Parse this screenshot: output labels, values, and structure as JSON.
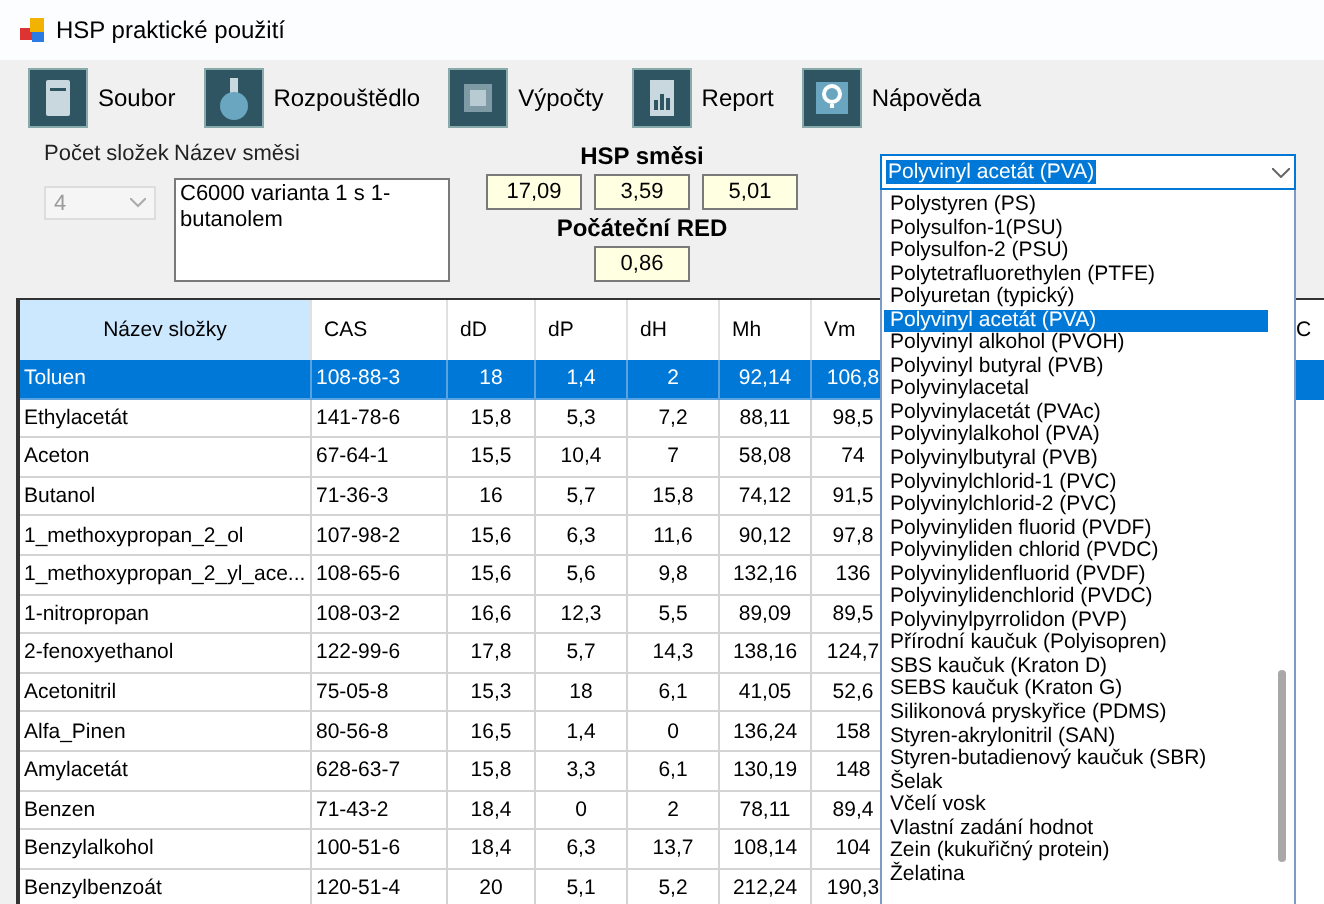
{
  "window": {
    "title": "HSP praktické použití"
  },
  "toolbar": [
    {
      "label": "Soubor"
    },
    {
      "label": "Rozpouštědlo"
    },
    {
      "label": "Výpočty"
    },
    {
      "label": "Report"
    },
    {
      "label": "Nápověda"
    }
  ],
  "component_count": {
    "label": "Počet složek",
    "value": "4",
    "disabled": true
  },
  "mixture_name": {
    "label": "Název směsi",
    "value": "C6000 varianta 1 s 1-butanolem"
  },
  "hsp_mixture": {
    "label": "HSP směsi",
    "values": [
      "17,09",
      "3,59",
      "5,01"
    ]
  },
  "initial_red": {
    "label": "Počáteční RED",
    "value": "0,86"
  },
  "polymer_select": {
    "value": "Polyvinyl acetát (PVA)",
    "expanded": true,
    "options": [
      {
        "label": "Polystyren (PS)",
        "selected": false
      },
      {
        "label": "Polysulfon-1(PSU)",
        "selected": false
      },
      {
        "label": "Polysulfon-2 (PSU)",
        "selected": false
      },
      {
        "label": "Polytetrafluorethylen (PTFE)",
        "selected": false
      },
      {
        "label": "Polyuretan (typický)",
        "selected": false
      },
      {
        "label": "Polyvinyl acetát (PVA)",
        "selected": true
      },
      {
        "label": "Polyvinyl alkohol (PVOH)",
        "selected": false
      },
      {
        "label": "Polyvinyl butyral (PVB)",
        "selected": false
      },
      {
        "label": "Polyvinylacetal",
        "selected": false
      },
      {
        "label": "Polyvinylacetát (PVAc)",
        "selected": false
      },
      {
        "label": "Polyvinylalkohol (PVA)",
        "selected": false
      },
      {
        "label": "Polyvinylbutyral (PVB)",
        "selected": false
      },
      {
        "label": "Polyvinylchlorid-1 (PVC)",
        "selected": false
      },
      {
        "label": "Polyvinylchlorid-2 (PVC)",
        "selected": false
      },
      {
        "label": "Polyvinyliden fluorid (PVDF)",
        "selected": false
      },
      {
        "label": "Polyvinyliden chlorid (PVDC)",
        "selected": false
      },
      {
        "label": "Polyvinylidenfluorid (PVDF)",
        "selected": false
      },
      {
        "label": "Polyvinylidenchlorid (PVDC)",
        "selected": false
      },
      {
        "label": "Polyvinylpyrrolidon (PVP)",
        "selected": false
      },
      {
        "label": "Přírodní kaučuk (Polyisopren)",
        "selected": false
      },
      {
        "label": "SBS kaučuk (Kraton D)",
        "selected": false
      },
      {
        "label": "SEBS kaučuk (Kraton G)",
        "selected": false
      },
      {
        "label": "Silikonová pryskyřice (PDMS)",
        "selected": false
      },
      {
        "label": "Styren-akrylonitril (SAN)",
        "selected": false
      },
      {
        "label": "Styren-butadienový kaučuk (SBR)",
        "selected": false
      },
      {
        "label": "Šelak",
        "selected": false
      },
      {
        "label": "Včelí vosk",
        "selected": false
      },
      {
        "label": "Vlastní zadání hodnot",
        "selected": false
      },
      {
        "label": "Zein (kukuřičný protein)",
        "selected": false
      },
      {
        "label": "Želatina",
        "selected": false
      }
    ]
  },
  "table": {
    "columns": [
      "Název složky",
      "CAS",
      "dD",
      "dP",
      "dH",
      "Mh",
      "Vm",
      "C"
    ],
    "rows": [
      {
        "selected": true,
        "cells": [
          "Toluen",
          "108-88-3",
          "18",
          "1,4",
          "2",
          "92,14",
          "106,8"
        ]
      },
      {
        "selected": false,
        "cells": [
          "Ethylacetát",
          "141-78-6",
          "15,8",
          "5,3",
          "7,2",
          "88,11",
          "98,5"
        ]
      },
      {
        "selected": false,
        "cells": [
          "Aceton",
          "67-64-1",
          "15,5",
          "10,4",
          "7",
          "58,08",
          "74"
        ]
      },
      {
        "selected": false,
        "cells": [
          "Butanol",
          "71-36-3",
          "16",
          "5,7",
          "15,8",
          "74,12",
          "91,5"
        ]
      },
      {
        "selected": false,
        "cells": [
          "1_methoxypropan_2_ol",
          "107-98-2",
          "15,6",
          "6,3",
          "11,6",
          "90,12",
          "97,8"
        ]
      },
      {
        "selected": false,
        "cells": [
          "1_methoxypropan_2_yl_ace...",
          "108-65-6",
          "15,6",
          "5,6",
          "9,8",
          "132,16",
          "136"
        ]
      },
      {
        "selected": false,
        "cells": [
          "1-nitropropan",
          "108-03-2",
          "16,6",
          "12,3",
          "5,5",
          "89,09",
          "89,5"
        ]
      },
      {
        "selected": false,
        "cells": [
          "2-fenoxyethanol",
          "122-99-6",
          "17,8",
          "5,7",
          "14,3",
          "138,16",
          "124,7"
        ]
      },
      {
        "selected": false,
        "cells": [
          "Acetonitril",
          "75-05-8",
          "15,3",
          "18",
          "6,1",
          "41,05",
          "52,6"
        ]
      },
      {
        "selected": false,
        "cells": [
          "Alfa_Pinen",
          "80-56-8",
          "16,5",
          "1,4",
          "0",
          "136,24",
          "158"
        ]
      },
      {
        "selected": false,
        "cells": [
          "Amylacetát",
          "628-63-7",
          "15,8",
          "3,3",
          "6,1",
          "130,19",
          "148"
        ]
      },
      {
        "selected": false,
        "cells": [
          "Benzen",
          "71-43-2",
          "18,4",
          "0",
          "2",
          "78,11",
          "89,4"
        ]
      },
      {
        "selected": false,
        "cells": [
          "Benzylalkohol",
          "100-51-6",
          "18,4",
          "6,3",
          "13,7",
          "108,14",
          "104"
        ]
      },
      {
        "selected": false,
        "cells": [
          "Benzylbenzoát",
          "120-51-4",
          "20",
          "5,1",
          "5,2",
          "212,24",
          "190,3"
        ]
      }
    ]
  }
}
